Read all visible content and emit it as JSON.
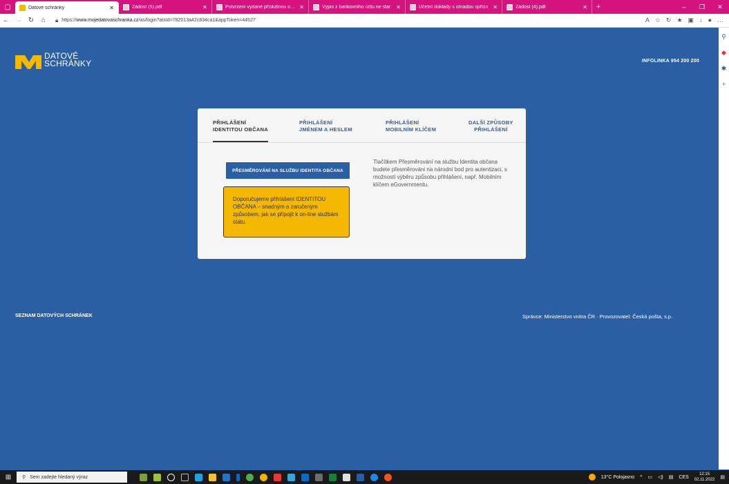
{
  "browser": {
    "tabs": [
      {
        "title": "Datové schránky",
        "type": "ds",
        "active": true
      },
      {
        "title": "Žádost (5).pdf",
        "type": "pdf"
      },
      {
        "title": "Potvrzení vydané příslušnou obc",
        "type": "pdf"
      },
      {
        "title": "Výpis z bankovního účtu ne star",
        "type": "pdf"
      },
      {
        "title": "Účetní doklady s úhradou spřízn",
        "type": "pdf"
      },
      {
        "title": "Žádost (4).pdf",
        "type": "pdf"
      }
    ],
    "new_tab": "+",
    "url_prefix": "https://",
    "url_host": "www.mojedatovaschranka.cz",
    "url_path": "/as/login?atsId=782013a42c834ca1&appToken=44527"
  },
  "header": {
    "logo_line1": "DATOVÉ",
    "logo_line2": "SCHRÁNKY",
    "infoline": "INFOLINKA 954 200 200"
  },
  "login": {
    "tabs": [
      {
        "line1": "PŘIHLÁŠENÍ",
        "line2": "IDENTITOU OBČANA"
      },
      {
        "line1": "PŘIHLÁŠENÍ",
        "line2": "JMÉNEM A HESLEM"
      },
      {
        "line1": "PŘIHLÁŠENÍ",
        "line2": "MOBILNÍM KLÍČEM"
      },
      {
        "line1": "DALŠÍ ZPŮSOBY",
        "line2": "PŘIHLÁŠENÍ"
      }
    ],
    "redirect_button": "PŘESMĚROVÁNÍ NA SLUŽBU IDENTITA OBČANA",
    "recommendation": "Doporučujeme přihlášení IDENTITOU OBČANA – snadným a zaručeným způsobem, jak se připojit k on-line službám státu.",
    "description": "Tlačítkem Přesměrování na službu Identita občana budete přesměrováni na národní bod pro autentizaci, s možností výběru způsobu přihlášení, např. Mobilním klíčem eGovernmentu."
  },
  "footer": {
    "left": "SEZNAM DATOVÝCH SCHRÁNEK",
    "right": "Správce: Ministerstvo vnitra ČR · Provozovatel: Česká pošta, s.p."
  },
  "taskbar": {
    "search_placeholder": "Sem zadejte hledaný výraz",
    "weather": "13°C Polojasno",
    "lang": "CES",
    "time": "12:15",
    "date": "02.11.2022"
  },
  "colors": {
    "brand_blue": "#2a5fa4",
    "accent_yellow": "#f5b800",
    "tab_bar": "#d6127f"
  }
}
